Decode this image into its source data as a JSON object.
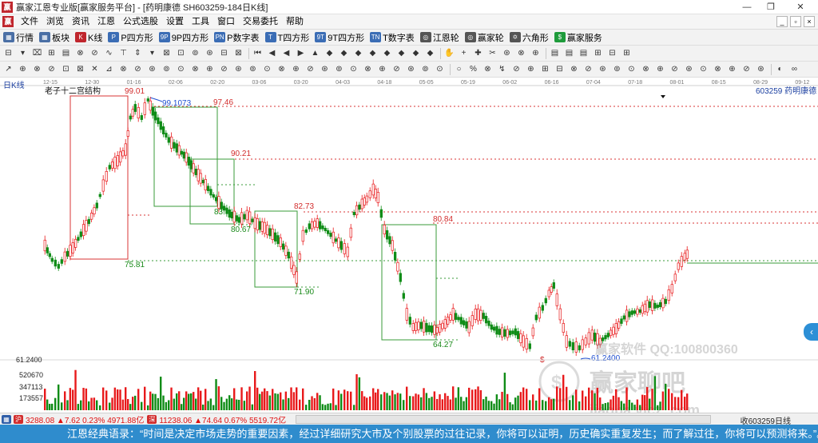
{
  "window": {
    "title": "赢家江恩专业版[赢家服务平台] - [药明康德  SH603259-184日K线]",
    "app_icon": "赢",
    "buttons": [
      "—",
      "❐",
      "✕"
    ]
  },
  "menubar": {
    "items": [
      "文件",
      "浏览",
      "资讯",
      "江恩",
      "公式选股",
      "设置",
      "工具",
      "窗口",
      "交易委托",
      "帮助"
    ]
  },
  "toolbar1": {
    "items": [
      {
        "label": "行情",
        "icon": "grid-icon",
        "glyph": "▦",
        "color": "#4a6fa5"
      },
      {
        "label": "板块",
        "icon": "blocks-icon",
        "glyph": "▦",
        "color": "#4a6fa5"
      },
      {
        "label": "K线",
        "icon": "candle-icon",
        "glyph": "K",
        "color": "#c0262d"
      },
      {
        "label": "P四方形",
        "icon": "p-square-icon",
        "glyph": "P",
        "color": "#3b6db5"
      },
      {
        "label": "9P四方形",
        "icon": "9p-square-icon",
        "glyph": "9P",
        "color": "#3b6db5"
      },
      {
        "label": "P数字表",
        "icon": "p-table-icon",
        "glyph": "PN",
        "color": "#3b6db5"
      },
      {
        "label": "T四方形",
        "icon": "t-square-icon",
        "glyph": "T",
        "color": "#3b6db5"
      },
      {
        "label": "9T四方形",
        "icon": "9t-square-icon",
        "glyph": "9T",
        "color": "#3b6db5"
      },
      {
        "label": "T数字表",
        "icon": "t-table-icon",
        "glyph": "TN",
        "color": "#3b6db5"
      },
      {
        "label": "江恩轮",
        "icon": "gann-wheel-icon",
        "glyph": "◎",
        "color": "#555555"
      },
      {
        "label": "赢家轮",
        "icon": "winner-wheel-icon",
        "glyph": "◎",
        "color": "#555555"
      },
      {
        "label": "六角形",
        "icon": "hexagon-icon",
        "glyph": "✡",
        "color": "#555555"
      },
      {
        "label": "赢家服务",
        "icon": "dollar-icon",
        "glyph": "$",
        "color": "#1e9b3b"
      }
    ]
  },
  "toolbar2": {
    "groups": [
      [
        "⊟",
        "▾",
        "⌧",
        "⊞",
        "▤",
        "⊗",
        "⊘",
        "∿",
        "⊤",
        "⇕",
        "▾",
        "⊠",
        "⊡",
        "⊚",
        "⊛",
        "⊟",
        "⊠"
      ],
      [
        "⏮",
        "◀",
        "◀",
        "▶",
        "▲",
        "◆",
        "◆",
        "◆",
        "◆",
        "◆",
        "◆",
        "◆",
        "◆"
      ],
      [
        "✋",
        "+",
        "✚",
        "✂",
        "⊛",
        "⊗",
        "⊕"
      ],
      [
        "▤",
        "▤",
        "▤",
        "⊞",
        "⊟",
        "⊞"
      ]
    ]
  },
  "toolbar3": {
    "groups": [
      [
        "↗",
        "⊕",
        "⊗",
        "⊘",
        "⊡",
        "⊠",
        "✕",
        "⊿",
        "⊗",
        "⊘",
        "⊛",
        "⊚",
        "⊙",
        "⊗",
        "⊕",
        "⊘",
        "⊛",
        "⊚",
        "⊙",
        "⊗",
        "⊕",
        "⊘",
        "⊛",
        "⊚",
        "⊙",
        "⊗",
        "⊕",
        "⊘",
        "⊛",
        "⊚",
        "⊙"
      ],
      [
        "○",
        "%",
        "⊗",
        "↯",
        "⊘",
        "⊕",
        "⊞",
        "⊟",
        "⊗",
        "⊘",
        "⊛",
        "⊚",
        "⊙",
        "⊗",
        "⊕",
        "⊘",
        "⊛",
        "⊙",
        "⊗",
        "⊕",
        "⊘",
        "⊛"
      ],
      [
        "◐",
        "∞"
      ]
    ]
  },
  "chart": {
    "period_label": "日K线",
    "structure_label": "老子十二宫结构",
    "stock_code_name": "603259  药明康德",
    "date_ticks": [
      "12-15",
      "12-30",
      "01-16",
      "02-06",
      "02-20",
      "03-06",
      "03-20",
      "04-03",
      "04-18",
      "05-05",
      "05-19",
      "06-02",
      "06-16",
      "07-04",
      "07-18",
      "08-01",
      "08-15",
      "08-29",
      "09-12"
    ],
    "price_labels": [
      {
        "text": "99.01",
        "color": "#d22c2c"
      },
      {
        "text": "99.1073",
        "color": "#1f4fd1"
      },
      {
        "text": "97.46",
        "color": "#d22c2c"
      },
      {
        "text": "90.21",
        "color": "#d22c2c"
      },
      {
        "text": "83.",
        "color": "#1a8a1a"
      },
      {
        "text": "82.73",
        "color": "#d22c2c"
      },
      {
        "text": "80.84",
        "color": "#d22c2c"
      },
      {
        "text": "80.67",
        "color": "#1a8a1a"
      },
      {
        "text": "75.81",
        "color": "#1a8a1a"
      },
      {
        "text": "71.90",
        "color": "#1a8a1a"
      },
      {
        "text": "64.27",
        "color": "#1a8a1a"
      },
      {
        "text": "61.2400",
        "color": "#1f4fd1"
      },
      {
        "text": "$",
        "color": "#d22c2c"
      }
    ],
    "bottom_price_left": "61.2400",
    "volume_labels": [
      "520670",
      "347113",
      "173557"
    ],
    "watermark": {
      "line1": "赢家软件  QQ:100800360",
      "line2": "赢家聊吧",
      "line3": "jiaoba.vjcz..com"
    },
    "colors": {
      "up": "#e8191b",
      "down": "#0f8c16",
      "box_red": "#d93434",
      "box_green": "#3a9b3a"
    }
  },
  "statusbar": {
    "index1": "3288.08 ▲7.62 0.23% 4971.88亿",
    "index2": "11238.06 ▲74.64 0.67% 5519.72亿",
    "right": "收603259日线"
  },
  "quote": "江恩经典语录：“时间是决定市场走势的重要因素，经过详细研究大市及个别股票的过往记录，你将可以证明，历史确实重复发生；而了解过往，你将可以预测将来。”。",
  "nav_arrow": "‹"
}
